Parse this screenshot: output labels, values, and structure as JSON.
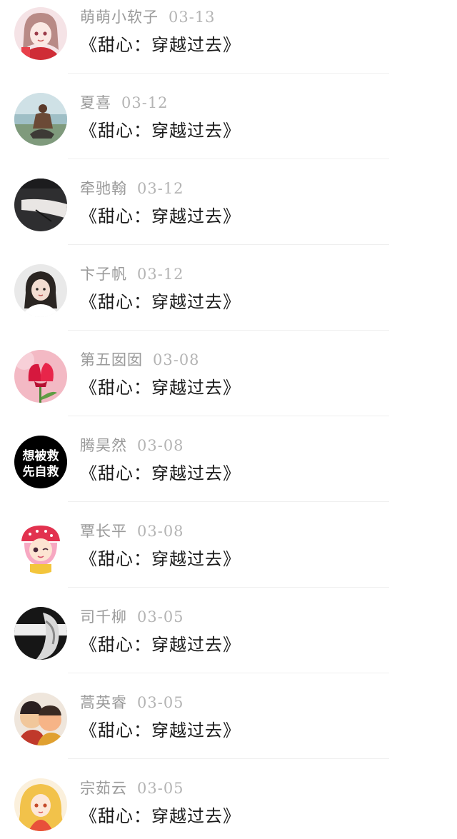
{
  "comments": [
    {
      "name": "萌萌小软子",
      "date": "03-13",
      "title": "《甜心：穿越过去》",
      "avatar": "anime-girl-avatar"
    },
    {
      "name": "夏喜",
      "date": "03-12",
      "title": "《甜心：穿越过去》",
      "avatar": "beach-man-avatar"
    },
    {
      "name": "牵驰翰",
      "date": "03-12",
      "title": "《甜心：穿越过去》",
      "avatar": "arm-bw-avatar"
    },
    {
      "name": "卞子帆",
      "date": "03-12",
      "title": "《甜心：穿越过去》",
      "avatar": "girl-portrait-avatar"
    },
    {
      "name": "第五囡囡",
      "date": "03-08",
      "title": "《甜心：穿越过去》",
      "avatar": "tulip-avatar"
    },
    {
      "name": "腾昊然",
      "date": "03-08",
      "title": "《甜心：穿越过去》",
      "avatar": "text-avatar",
      "avatar_text": [
        "想被救",
        "先自救"
      ]
    },
    {
      "name": "覃长平",
      "date": "03-08",
      "title": "《甜心：穿越过去》",
      "avatar": "cartoon-girl-avatar"
    },
    {
      "name": "司千柳",
      "date": "03-05",
      "title": "《甜心：穿越过去》",
      "avatar": "bw-face-avatar"
    },
    {
      "name": "蒿英睿",
      "date": "03-05",
      "title": "《甜心：穿越过去》",
      "avatar": "doll-pair-avatar"
    },
    {
      "name": "宗茹云",
      "date": "03-05",
      "title": "《甜心：穿越过去》",
      "avatar": "anime-blonde-avatar"
    }
  ]
}
